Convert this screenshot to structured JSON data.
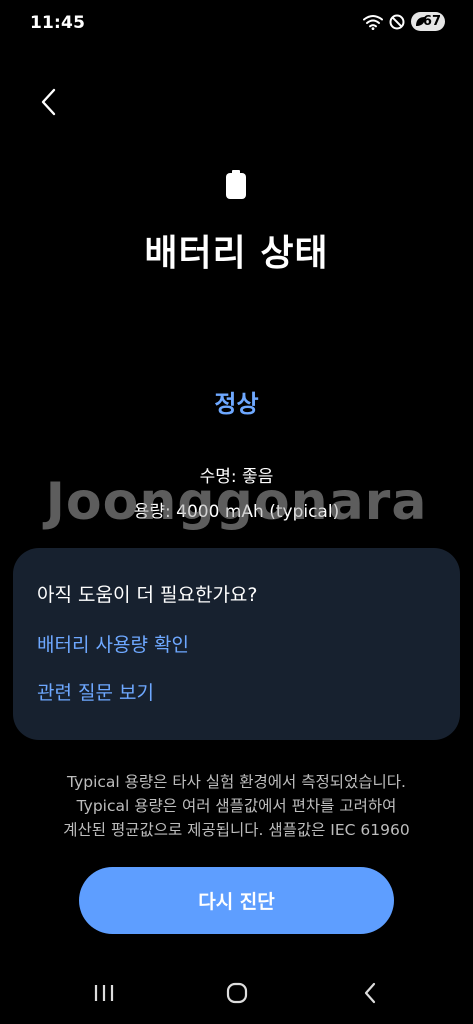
{
  "status_bar": {
    "time": "11:45",
    "battery_level": "67",
    "icons": [
      "wifi-icon",
      "do-not-disturb-icon",
      "battery-icon"
    ]
  },
  "header": {
    "back_icon": "chevron-left-icon",
    "hero_icon": "battery-icon",
    "title": "배터리 상태"
  },
  "battery": {
    "status": "정상",
    "lifespan": "수명: 좋음",
    "capacity": "용량: 4000 mAh (typical)"
  },
  "watermark": "Joonggonara",
  "help_card": {
    "title": "아직 도움이 더 필요한가요?",
    "links": [
      "배터리 사용량 확인",
      "관련 질문 보기"
    ]
  },
  "note": {
    "lines": [
      "Typical 용량은 타사 실험 환경에서 측정되었습니다.",
      "Typical 용량은 여러 샘플값에서 편차를 고려하여",
      "계산된 평균값으로 제공됩니다. 샘플값은 IEC 61960"
    ]
  },
  "actions": {
    "diagnose_label": "다시 진단"
  },
  "nav": {
    "icons": [
      "recents-icon",
      "home-icon",
      "back-icon"
    ]
  },
  "colors": {
    "background": "#000000",
    "accent": "#6ea8ff",
    "card": "#17212f",
    "button": "#5e9eff"
  }
}
